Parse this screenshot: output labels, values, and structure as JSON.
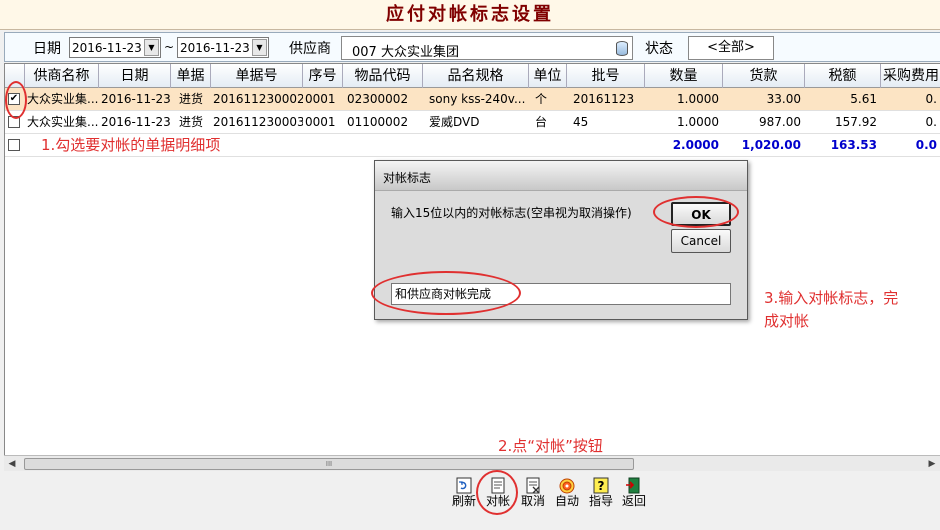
{
  "window": {
    "title": "应付对帐标志设置"
  },
  "filters": {
    "date_label": "日期",
    "date_from": "2016-11-23",
    "date_sep": "~",
    "date_to": "2016-11-23",
    "supplier_label": "供应商",
    "supplier_value": "007  大众实业集团",
    "status_label": "状态",
    "status_value": "<全部>"
  },
  "grid": {
    "columns": [
      "供商名称",
      "日期",
      "单据",
      "单据号",
      "序号",
      "物品代码",
      "品名规格",
      "单位",
      "批号",
      "数量",
      "货款",
      "税额",
      "采购费用"
    ],
    "rows": [
      {
        "checked": true,
        "cells": [
          "大众实业集...",
          "2016-11-23",
          "进货",
          "201611230002",
          "0001",
          "02300002",
          "sony kss-240v...",
          "个",
          "20161123",
          "1.0000",
          "33.00",
          "5.61",
          "0."
        ]
      },
      {
        "checked": false,
        "cells": [
          "大众实业集...",
          "2016-11-23",
          "进货",
          "201611230003",
          "0001",
          "01100002",
          "爱威DVD",
          "台",
          "45",
          "1.0000",
          "987.00",
          "157.92",
          "0."
        ]
      }
    ],
    "total_row": {
      "qty": "2.0000",
      "amount": "1,020.00",
      "tax": "163.53",
      "fee": "0.0"
    },
    "check_mark": "✔"
  },
  "annotations": {
    "step1": "1.勾选要对帐的单据明细项",
    "step2": "2.点“对帐”按钮",
    "step3_line1": "3.输入对帐标志，完",
    "step3_line2": "成对帐"
  },
  "dialog": {
    "title": "对帐标志",
    "prompt": "输入15位以内的对帐标志(空串视为取消操作)",
    "ok_label": "OK",
    "cancel_label": "Cancel",
    "input_value": "和供应商对帐完成"
  },
  "toolbar": {
    "buttons": [
      {
        "label": "刷新",
        "icon": "refresh-icon"
      },
      {
        "label": "对帐",
        "icon": "reconcile-icon"
      },
      {
        "label": "取消",
        "icon": "cancel-doc-icon"
      },
      {
        "label": "自动",
        "icon": "auto-target-icon"
      },
      {
        "label": "指导",
        "icon": "help-icon"
      },
      {
        "label": "返回",
        "icon": "exit-icon"
      }
    ]
  },
  "scrollbar": {
    "grip": "III"
  },
  "colors": {
    "title_text": "#800000",
    "annotation": "#e03030",
    "selected_row": "#fce4c4",
    "totals_text": "#0000cc"
  }
}
